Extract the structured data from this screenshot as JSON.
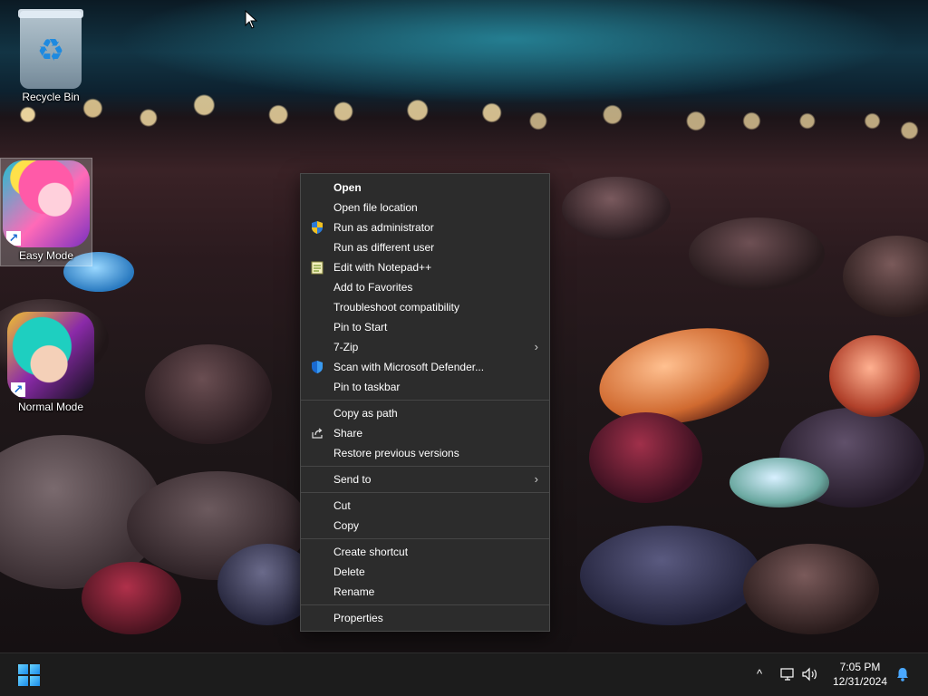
{
  "desktop": {
    "icons": [
      {
        "label": "Recycle Bin",
        "icon": "recycle-bin-icon"
      },
      {
        "label": "Easy Mode",
        "icon": "app-shortcut-icon"
      },
      {
        "label": "Normal Mode",
        "icon": "app-shortcut-icon"
      }
    ]
  },
  "context_menu": {
    "items": [
      {
        "label": "Open",
        "bold": true
      },
      {
        "label": "Open file location"
      },
      {
        "label": "Run as administrator",
        "icon": "uac-shield-icon"
      },
      {
        "label": "Run as different user"
      },
      {
        "label": "Edit with Notepad++",
        "icon": "notepad-plus-plus-icon"
      },
      {
        "label": "Add to Favorites"
      },
      {
        "label": "Troubleshoot compatibility"
      },
      {
        "label": "Pin to Start"
      },
      {
        "label": "7-Zip",
        "submenu": true
      },
      {
        "label": "Scan with Microsoft Defender...",
        "icon": "defender-shield-icon"
      },
      {
        "label": "Pin to taskbar"
      },
      {
        "label": "Copy as path"
      },
      {
        "label": "Share",
        "icon": "share-icon"
      },
      {
        "label": "Restore previous versions"
      },
      {
        "label": "Send to",
        "submenu": true
      },
      {
        "label": "Cut"
      },
      {
        "label": "Copy"
      },
      {
        "label": "Create shortcut"
      },
      {
        "label": "Delete"
      },
      {
        "label": "Rename"
      },
      {
        "label": "Properties"
      }
    ]
  },
  "taskbar": {
    "time": "7:05 PM",
    "date": "12/31/2024",
    "tray_icons": [
      "chevron-up-icon",
      "network-icon",
      "volume-icon",
      "notification-bell-icon"
    ]
  },
  "colors": {
    "menu_bg": "#2c2c2c",
    "taskbar_bg": "#1c1c1c",
    "accent": "#1a8ae8"
  }
}
